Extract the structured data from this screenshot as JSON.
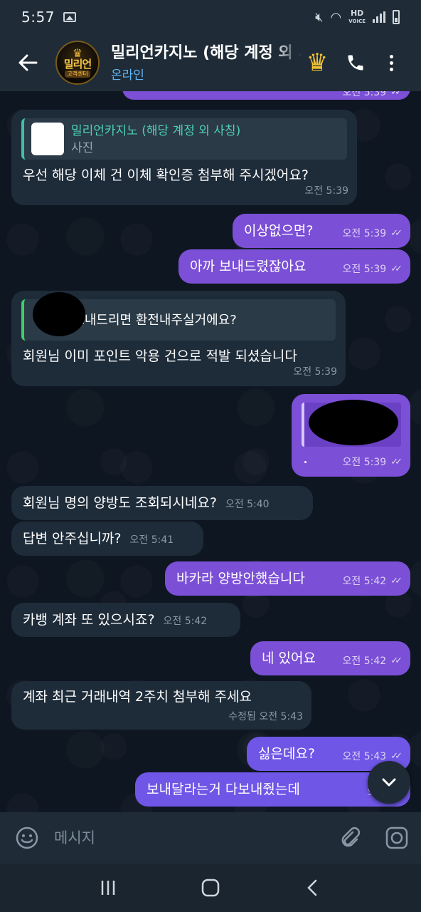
{
  "status_bar": {
    "time": "5:57",
    "network_label": "HD",
    "network_sub": "VOICE"
  },
  "header": {
    "back_icon": "arrow-left-icon",
    "avatar": {
      "name": "밀리언",
      "sub": "고객센터"
    },
    "title": "밀리언카지노 (해당 계정 외 사칭)",
    "status": "온라인",
    "crown_icon": "crown-icon",
    "accent_status": "#5fb4f2"
  },
  "messages": [
    {
      "dir": "out",
      "time": "오전 5:39",
      "partial": true
    },
    {
      "dir": "in",
      "reply": {
        "name": "밀리언카지노 (해당 계정 외 사칭)",
        "sub": "사진"
      },
      "text": "우선 해당 이체 건 이체 확인증 첨부해 주시겠어요?",
      "time": "오전 5:39"
    },
    {
      "dir": "out",
      "text": "이상없으면?",
      "time": "오전 5:39"
    },
    {
      "dir": "out",
      "text": "아까 보내드렸잖아요",
      "time": "오전 5:39"
    },
    {
      "dir": "in",
      "reply": {
        "text": "거 보내드리면 환전내주실거에요?"
      },
      "text": "회원님 이미 포인트 악용 건으로 적발 되셨습니다",
      "time": "오전 5:39"
    },
    {
      "dir": "out",
      "image_redacted": true,
      "time": "오전 5:39"
    },
    {
      "dir": "in",
      "text": "회원님 명의 양방도 조회되시네요?",
      "time": "오전 5:40"
    },
    {
      "dir": "in",
      "text": "답변 안주십니까?",
      "time": "오전 5:41"
    },
    {
      "dir": "out",
      "text": "바카라 양방안했습니다",
      "time": "오전 5:42"
    },
    {
      "dir": "in",
      "text": "카뱅 계좌 또 있으시죠?",
      "time": "오전 5:42"
    },
    {
      "dir": "out",
      "text": "네 있어요",
      "time": "오전 5:42"
    },
    {
      "dir": "in",
      "text": "계좌 최근 거래내역 2주치 첨부해 주세요",
      "time": "수정됨 오전 5:43"
    },
    {
      "dir": "out",
      "text": "싫은데요?",
      "time": "오전 5:43"
    },
    {
      "dir": "out",
      "text": "보내달라는거 다보내줬는데",
      "time": "오전 5:4"
    }
  ],
  "input": {
    "placeholder": "메시지",
    "emoji_icon": "emoji-icon",
    "attach_icon": "paperclip-icon",
    "camera_icon": "camera-icon"
  },
  "colors": {
    "incoming_bubble": "#1e2c3a",
    "outgoing_bubble": "#7b4fd6",
    "header_bg": "#1f2c38",
    "reply_accent": "#3ec1a7"
  }
}
